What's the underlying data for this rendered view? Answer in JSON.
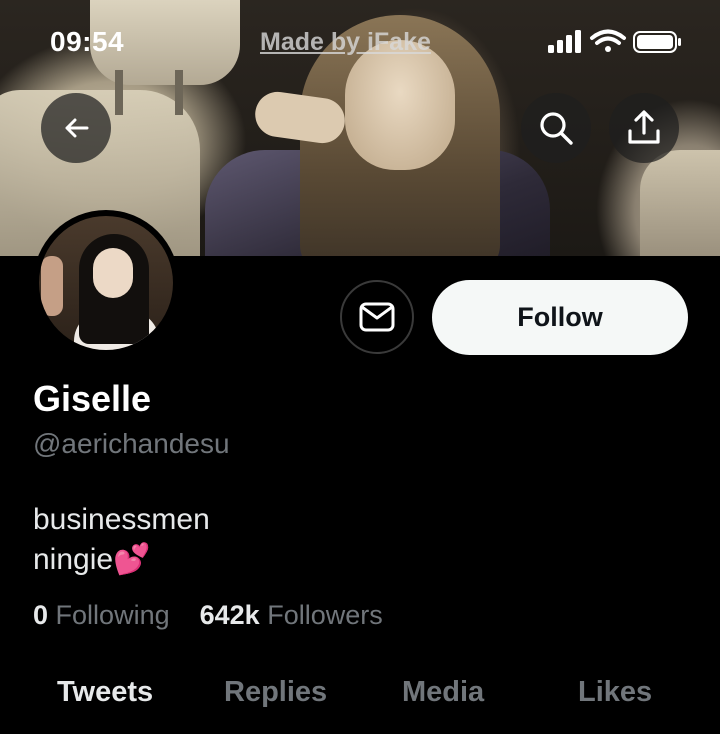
{
  "status_bar": {
    "time": "09:54",
    "watermark": "Made by iFake",
    "icons": [
      "signal-icon",
      "wifi-icon",
      "battery-icon"
    ]
  },
  "header": {
    "back_icon": "arrow-left-icon",
    "search_icon": "search-icon",
    "share_icon": "share-icon"
  },
  "profile": {
    "name": "Giselle",
    "handle": "@aerichandesu",
    "bio_lines": [
      "businessmen",
      "ningie💕"
    ],
    "following_count": "0",
    "following_label": "Following",
    "followers_count": "642k",
    "followers_label": "Followers"
  },
  "actions": {
    "message_icon": "envelope-icon",
    "follow_label": "Follow"
  },
  "tabs": [
    {
      "label": "Tweets",
      "active": true
    },
    {
      "label": "Replies",
      "active": false
    },
    {
      "label": "Media",
      "active": false
    },
    {
      "label": "Likes",
      "active": false
    }
  ],
  "colors": {
    "background": "#000000",
    "primary_text": "#e7e9ea",
    "secondary_text": "#71767b",
    "follow_button_bg": "#f5f8f7"
  }
}
